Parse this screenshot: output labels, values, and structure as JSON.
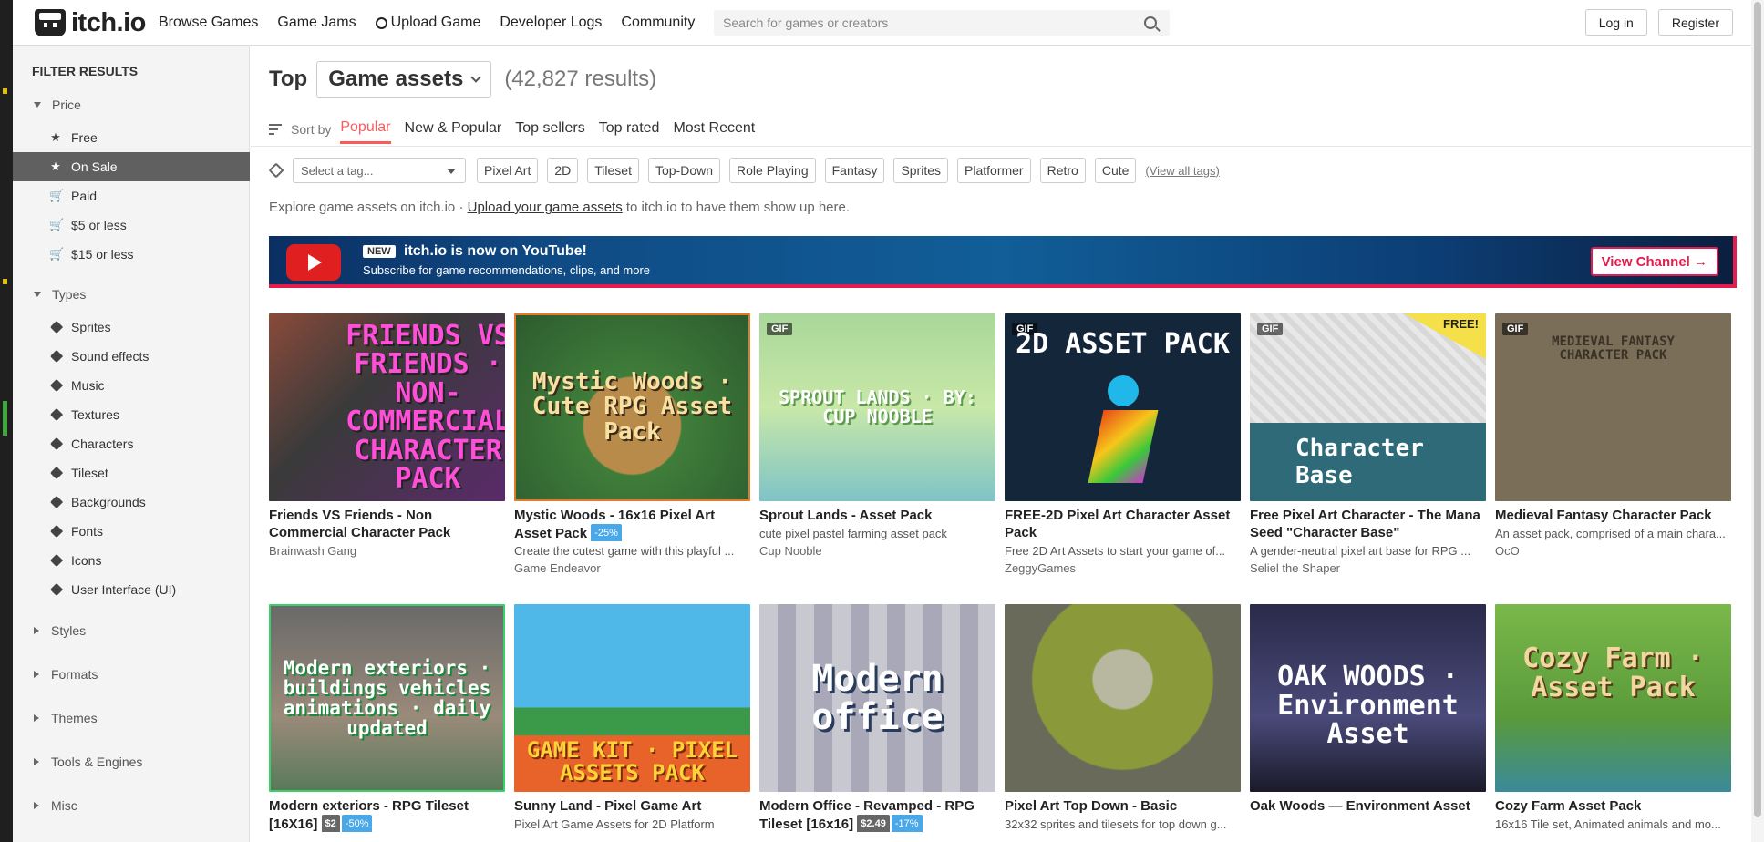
{
  "header": {
    "logo": "itch.io",
    "nav": [
      "Browse Games",
      "Game Jams",
      "Upload Game",
      "Developer Logs",
      "Community"
    ],
    "search_placeholder": "Search for games or creators",
    "login": "Log in",
    "register": "Register"
  },
  "sidebar": {
    "title": "FILTER RESULTS",
    "price": {
      "heading": "Price",
      "items": [
        {
          "label": "Free",
          "icon": "star-icon"
        },
        {
          "label": "On Sale",
          "icon": "star-icon",
          "active": true
        },
        {
          "label": "Paid",
          "icon": "cart-icon"
        },
        {
          "label": "$5 or less",
          "icon": "cart-icon"
        },
        {
          "label": "$15 or less",
          "icon": "cart-icon"
        }
      ]
    },
    "types": {
      "heading": "Types",
      "items": [
        "Sprites",
        "Sound effects",
        "Music",
        "Textures",
        "Characters",
        "Tileset",
        "Backgrounds",
        "Fonts",
        "Icons",
        "User Interface (UI)"
      ]
    },
    "collapsed": [
      "Styles",
      "Formats",
      "Themes",
      "Tools & Engines",
      "Misc"
    ]
  },
  "main": {
    "top_label": "Top",
    "category": "Game assets",
    "count": "(42,827 results)",
    "sort_label": "Sort by",
    "sort_options": [
      "Popular",
      "New & Popular",
      "Top sellers",
      "Top rated",
      "Most Recent"
    ],
    "tag_placeholder": "Select a tag...",
    "tags": [
      "Pixel Art",
      "2D",
      "Tileset",
      "Top-Down",
      "Role Playing",
      "Fantasy",
      "Sprites",
      "Platformer",
      "Retro",
      "Cute"
    ],
    "view_all_tags": "(View all tags)",
    "explore_prefix": "Explore game assets on itch.io ·",
    "explore_link": "Upload your game assets",
    "explore_suffix": "to itch.io to have them show up here."
  },
  "banner": {
    "new": "NEW",
    "title": "itch.io is now on YouTube!",
    "subtitle": "Subscribe for game recommendations, clips, and more",
    "button": "View Channel →"
  },
  "games": [
    {
      "title": "Friends VS Friends - Non Commercial Character Pack",
      "desc": "",
      "author": "Brainwash Gang",
      "art": "FRIENDS VS FRIENDS · NON-COMMERCIAL CHARACTER PACK"
    },
    {
      "title": "Mystic Woods - 16x16 Pixel Art Asset Pack",
      "discount": "-25%",
      "desc": "Create the cutest game with this playful ...",
      "author": "Game Endeavor",
      "art": "Mystic Woods · Cute RPG Asset Pack"
    },
    {
      "title": "Sprout Lands - Asset Pack",
      "desc": "cute pixel pastel farming asset pack",
      "author": "Cup Nooble",
      "gif": "GIF",
      "art": "SPROUT LANDS · BY: CUP NOOBLE"
    },
    {
      "title": "FREE-2D Pixel Art Character Asset Pack",
      "desc": "Free 2D Art Assets to start your game of...",
      "author": "ZeggyGames",
      "gif": "GIF",
      "art": "2D ASSET PACK"
    },
    {
      "title": "Free Pixel Art Character - The Mana Seed \"Character Base\"",
      "desc": "A gender-neutral pixel art base for RPG ...",
      "author": "Seliel the Shaper",
      "gif": "GIF",
      "free": "FREE!",
      "art": "Character Base"
    },
    {
      "title": "Medieval Fantasy Character Pack",
      "desc": "An asset pack, comprised of a main chara...",
      "author": "OcO",
      "gif": "GIF",
      "art": "MEDIEVAL FANTASY CHARACTER PACK"
    },
    {
      "title": "Modern exteriors - RPG Tileset [16X16]",
      "price": "$2",
      "discount": "-50%",
      "desc": "",
      "author": "",
      "art": "Modern exteriors · buildings vehicles animations · daily updated"
    },
    {
      "title": "Sunny Land - Pixel Game Art",
      "desc": "Pixel Art Game Assets for 2D Platform",
      "author": "",
      "art": "GAME KIT · PIXEL ASSETS PACK"
    },
    {
      "title": "Modern Office - Revamped - RPG Tileset [16x16]",
      "price": "$2.49",
      "discount": "-17%",
      "desc": "",
      "author": "",
      "art": "Modern office"
    },
    {
      "title": "Pixel Art Top Down - Basic",
      "desc": "32x32 sprites and tilesets for top down g...",
      "author": "",
      "art": ""
    },
    {
      "title": "Oak Woods — Environment Asset",
      "desc": "",
      "author": "",
      "art": "OAK WOODS · Environment Asset"
    },
    {
      "title": "Cozy Farm Asset Pack",
      "desc": "16x16 Tile set, Animated animals and mo...",
      "author": "",
      "art": "Cozy Farm · Asset Pack"
    }
  ]
}
